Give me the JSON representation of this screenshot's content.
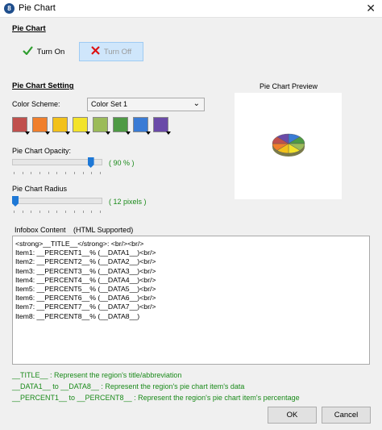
{
  "window": {
    "title": "Pie Chart",
    "app_icon_letter": "8",
    "close_glyph": "✕"
  },
  "pie_chart_section": {
    "title": "Pie Chart",
    "turn_on_label": "Turn On",
    "turn_off_label": "Turn Off"
  },
  "setting_section": {
    "title": "Pie Chart Setting",
    "color_scheme_label": "Color Scheme:",
    "color_scheme_value": "Color Set 1",
    "swatches": [
      "#c0504d",
      "#f07f2c",
      "#f2c11a",
      "#f3e32a",
      "#9bbb59",
      "#4e9a44",
      "#3a7bd5",
      "#6a4aa8"
    ],
    "opacity_label": "Pie Chart Opacity:",
    "opacity_value_text": "( 90 % )",
    "opacity_level": 0.9,
    "radius_label": "Pie Chart Radius",
    "radius_value_text": "( 12 pixels )",
    "radius_level": 0.0
  },
  "preview": {
    "title": "Pie Chart Preview",
    "slice_colors": [
      "#3a7bd5",
      "#4e9a44",
      "#9bbb59",
      "#f3e32a",
      "#f2c11a",
      "#f07f2c",
      "#c0504d",
      "#6a4aa8"
    ]
  },
  "infobox": {
    "label": "Infobox Content",
    "supported": "(HTML Supported)",
    "lines": [
      "<strong>__TITLE__</strong>: <br/><br/>",
      "Item1: __PERCENT1__% (__DATA1__)<br/>",
      "Item2: __PERCENT2__% (__DATA2__)<br/>",
      "Item3: __PERCENT3__% (__DATA3__)<br/>",
      "Item4: __PERCENT4__% (__DATA4__)<br/>",
      "Item5: __PERCENT5__% (__DATA5__)<br/>",
      "Item6: __PERCENT6__% (__DATA6__)<br/>",
      "Item7: __PERCENT7__% (__DATA7__)<br/>",
      "Item8: __PERCENT8__% (__DATA8__)"
    ]
  },
  "help": {
    "line1": "__TITLE__ : Represent the region's title/abbreviation",
    "line2": "__DATA1__ to __DATA8__ : Represent the region's pie chart item's data",
    "line3": "__PERCENT1__ to __PERCENT8__ : Represent the region's pie chart item's percentage"
  },
  "footer": {
    "ok_label": "OK",
    "cancel_label": "Cancel"
  },
  "colors": {
    "help_text": "#1a8a1a",
    "slider_thumb": "#1e78d6",
    "check": "#2e9e2e",
    "cross": "#d11"
  },
  "icons": {
    "turn_on": "check-icon",
    "turn_off": "cross-icon"
  }
}
